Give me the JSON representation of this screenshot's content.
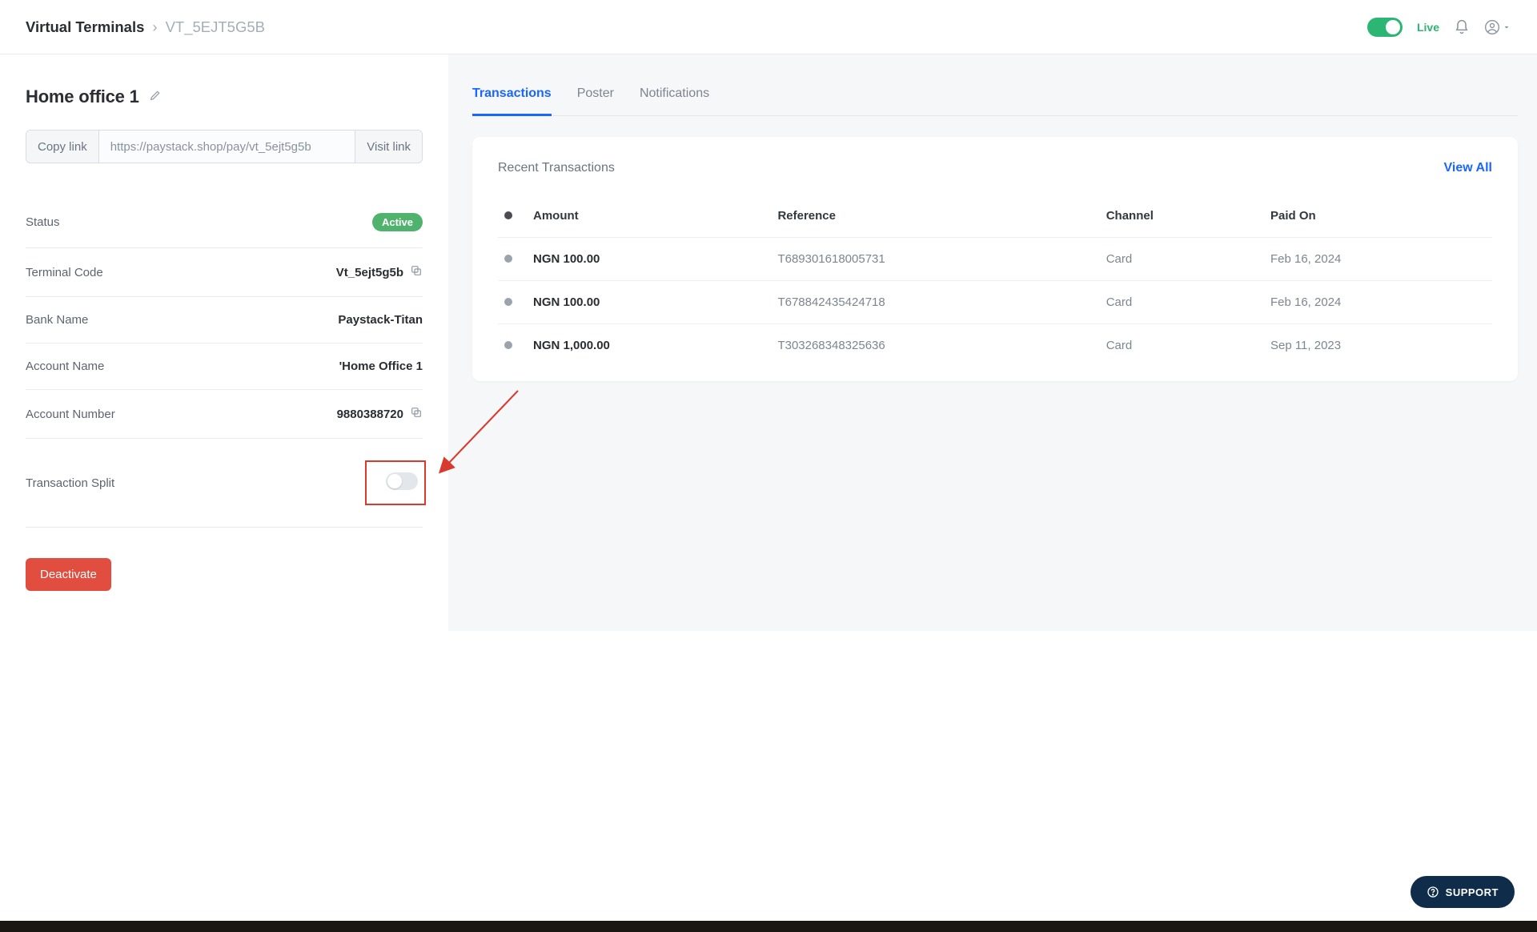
{
  "breadcrumb": {
    "root": "Virtual Terminals",
    "current": "VT_5EJT5G5B"
  },
  "header": {
    "live_label": "Live"
  },
  "terminal": {
    "title": "Home office 1",
    "copy_link_label": "Copy link",
    "url": "https://paystack.shop/pay/vt_5ejt5g5b",
    "visit_link_label": "Visit link",
    "details": {
      "status_label": "Status",
      "status_value": "Active",
      "code_label": "Terminal Code",
      "code_value": "Vt_5ejt5g5b",
      "bank_label": "Bank Name",
      "bank_value": "Paystack-Titan",
      "acct_name_label": "Account Name",
      "acct_name_value": "'Home Office 1",
      "acct_num_label": "Account Number",
      "acct_num_value": "9880388720",
      "split_label": "Transaction Split"
    },
    "deactivate_label": "Deactivate"
  },
  "tabs": {
    "transactions": "Transactions",
    "poster": "Poster",
    "notifications": "Notifications"
  },
  "transactions_card": {
    "heading": "Recent Transactions",
    "view_all": "View All",
    "columns": {
      "amount": "Amount",
      "reference": "Reference",
      "channel": "Channel",
      "paid_on": "Paid On"
    },
    "rows": [
      {
        "amount": "NGN 100.00",
        "reference": "T689301618005731",
        "channel": "Card",
        "paid_on": "Feb 16, 2024"
      },
      {
        "amount": "NGN 100.00",
        "reference": "T678842435424718",
        "channel": "Card",
        "paid_on": "Feb 16, 2024"
      },
      {
        "amount": "NGN 1,000.00",
        "reference": "T303268348325636",
        "channel": "Card",
        "paid_on": "Sep 11, 2023"
      }
    ]
  },
  "support_label": "SUPPORT"
}
